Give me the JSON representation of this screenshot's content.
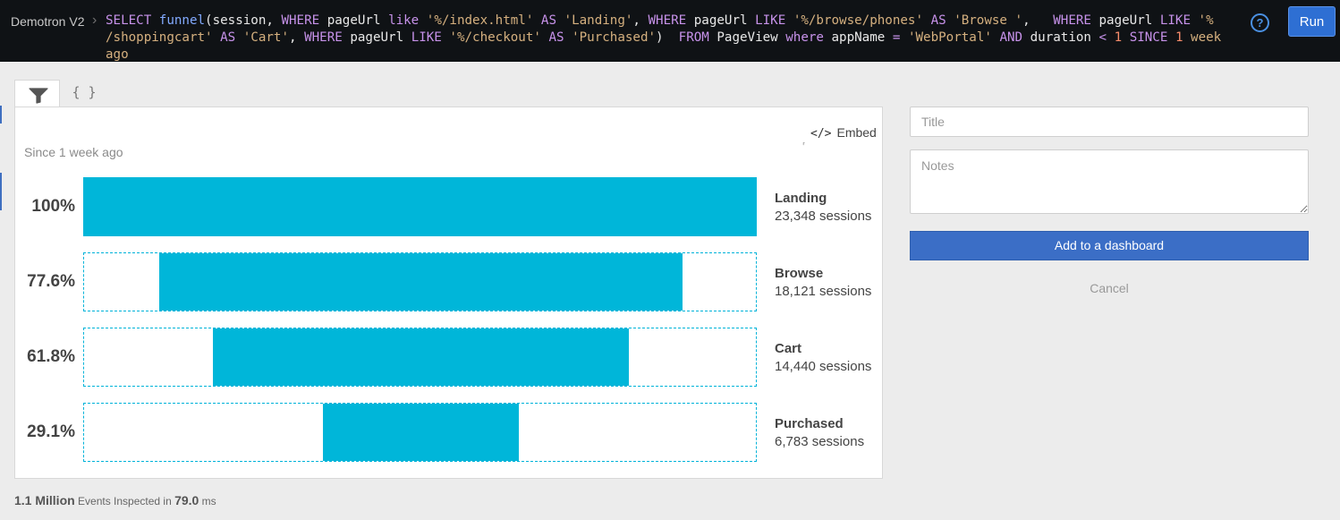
{
  "header": {
    "account_name": "Demotron V2",
    "query_segments": [
      {
        "t": "SELECT ",
        "c": "kw"
      },
      {
        "t": "funnel",
        "c": "fn"
      },
      {
        "t": "(session, ",
        "c": "txt"
      },
      {
        "t": "WHERE ",
        "c": "kw"
      },
      {
        "t": "pageUrl ",
        "c": "txt"
      },
      {
        "t": "like ",
        "c": "kw"
      },
      {
        "t": "'%/index.html' ",
        "c": "str"
      },
      {
        "t": "AS ",
        "c": "kw"
      },
      {
        "t": "'Landing'",
        "c": "str"
      },
      {
        "t": ", ",
        "c": "txt"
      },
      {
        "t": "WHERE ",
        "c": "kw"
      },
      {
        "t": "pageUrl ",
        "c": "txt"
      },
      {
        "t": "LIKE ",
        "c": "kw"
      },
      {
        "t": "'%/browse/phones' ",
        "c": "str"
      },
      {
        "t": "AS ",
        "c": "kw"
      },
      {
        "t": "'Browse '",
        "c": "str"
      },
      {
        "t": ",   ",
        "c": "txt"
      },
      {
        "t": "WHERE ",
        "c": "kw"
      },
      {
        "t": "pageUrl ",
        "c": "txt"
      },
      {
        "t": "LIKE ",
        "c": "kw"
      },
      {
        "t": "'%\n/shoppingcart' ",
        "c": "str"
      },
      {
        "t": "AS ",
        "c": "kw"
      },
      {
        "t": "'Cart'",
        "c": "str"
      },
      {
        "t": ", ",
        "c": "txt"
      },
      {
        "t": "WHERE ",
        "c": "kw"
      },
      {
        "t": "pageUrl ",
        "c": "txt"
      },
      {
        "t": "LIKE ",
        "c": "kw"
      },
      {
        "t": "'%/checkout' ",
        "c": "str"
      },
      {
        "t": "AS ",
        "c": "kw"
      },
      {
        "t": "'Purchased'",
        "c": "str"
      },
      {
        "t": ")  ",
        "c": "txt"
      },
      {
        "t": "FROM ",
        "c": "kw"
      },
      {
        "t": "PageView ",
        "c": "txt"
      },
      {
        "t": "where ",
        "c": "kw"
      },
      {
        "t": "appName ",
        "c": "txt"
      },
      {
        "t": "= ",
        "c": "kw"
      },
      {
        "t": "'WebPortal' ",
        "c": "str"
      },
      {
        "t": "AND ",
        "c": "kw"
      },
      {
        "t": "duration ",
        "c": "txt"
      },
      {
        "t": "< ",
        "c": "kw"
      },
      {
        "t": "1 ",
        "c": "num"
      },
      {
        "t": "SINCE ",
        "c": "kw"
      },
      {
        "t": "1 ",
        "c": "num"
      },
      {
        "t": "week ago",
        "c": "str"
      }
    ],
    "help_glyph": "?",
    "run_label": "Run"
  },
  "tabs": {
    "funnel_icon": "funnel-icon",
    "json_label": "{ }"
  },
  "chart_panel": {
    "embed_icon": "</>",
    "embed_label": "Embed",
    "small_mark": "⸢",
    "since_label": "Since 1 week ago"
  },
  "chart_data": {
    "type": "bar",
    "subtitle": "Since 1 week ago",
    "steps": [
      {
        "name": "Landing",
        "percent": 100,
        "percent_label": "100%",
        "sessions": 23348,
        "count_label": "23,348 sessions"
      },
      {
        "name": "Browse",
        "percent": 77.6,
        "percent_label": "77.6%",
        "sessions": 18121,
        "count_label": "18,121 sessions"
      },
      {
        "name": "Cart",
        "percent": 61.8,
        "percent_label": "61.8%",
        "sessions": 14440,
        "count_label": "14,440 sessions"
      },
      {
        "name": "Purchased",
        "percent": 29.1,
        "percent_label": "29.1%",
        "sessions": 6783,
        "count_label": "6,783 sessions"
      }
    ],
    "bar_color": "#00b6d9"
  },
  "footer": {
    "events_count": "1.1 Million",
    "events_text": " Events Inspected in ",
    "time_value": "79.0",
    "time_unit": " ms"
  },
  "form": {
    "title_placeholder": "Title",
    "notes_placeholder": "Notes",
    "add_button_label": "Add to a dashboard",
    "cancel_label": "Cancel"
  },
  "colors": {
    "accent": "#3b6ec6",
    "query_bg": "#0f1215",
    "run_button": "#2e6fd3"
  }
}
